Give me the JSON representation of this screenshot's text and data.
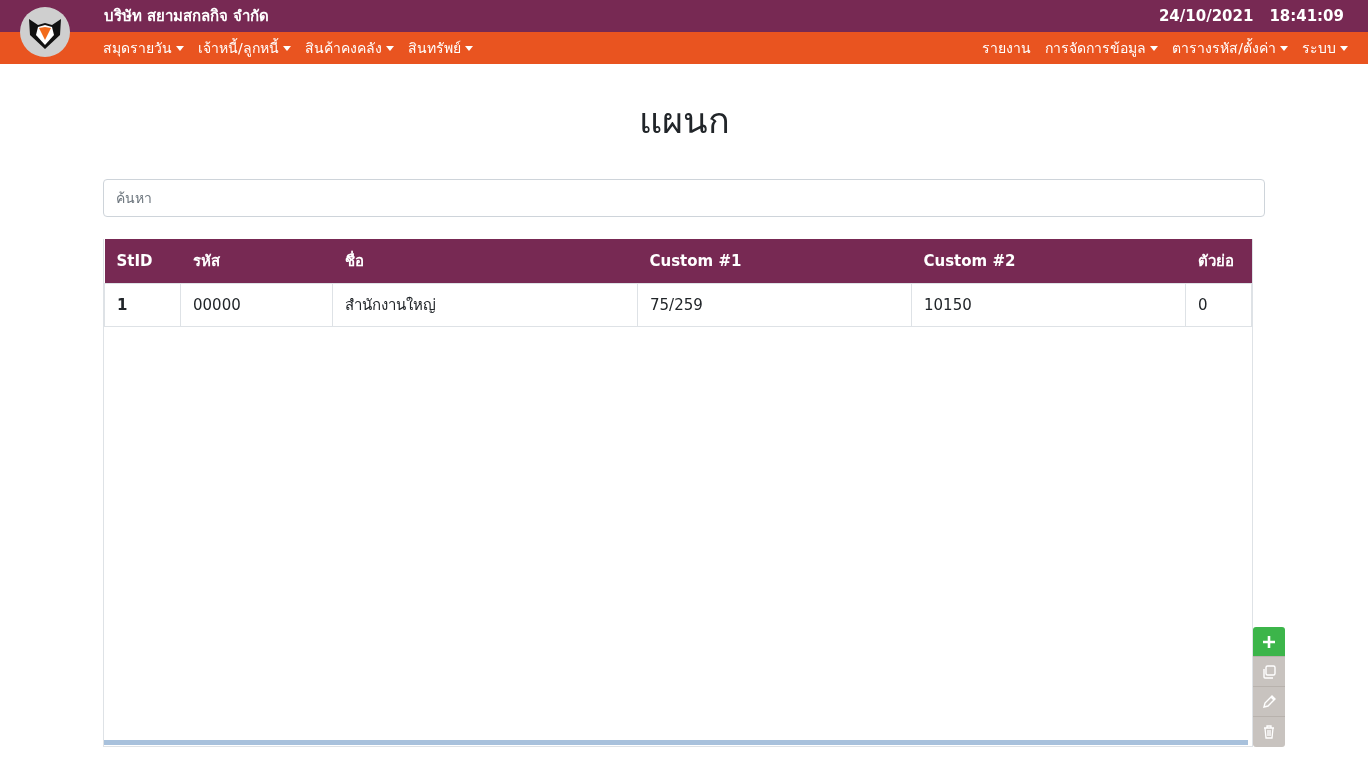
{
  "header": {
    "company": "บริษัท สยามสกลกิจ จำกัด",
    "date": "24/10/2021",
    "time": "18:41:09"
  },
  "nav_left": [
    {
      "label": "สมุดรายวัน",
      "dropdown": true
    },
    {
      "label": "เจ้าหนี้/ลูกหนี้",
      "dropdown": true
    },
    {
      "label": "สินค้าคงคลัง",
      "dropdown": true
    },
    {
      "label": "สินทรัพย์",
      "dropdown": true
    }
  ],
  "nav_right": [
    {
      "label": "รายงาน",
      "dropdown": false
    },
    {
      "label": "การจัดการข้อมูล",
      "dropdown": true
    },
    {
      "label": "ตารางรหัส/ตั้งค่า",
      "dropdown": true
    },
    {
      "label": "ระบบ",
      "dropdown": true
    }
  ],
  "page_title": "แผนก",
  "search": {
    "placeholder": "ค้นหา"
  },
  "table": {
    "columns": [
      "StID",
      "รหัส",
      "ชื่อ",
      "Custom #1",
      "Custom #2",
      "ตัวย่อ"
    ],
    "rows": [
      {
        "cells": [
          "1",
          "00000",
          "สำนักงานใหญ่",
          "75/259",
          "10150",
          "0"
        ],
        "selected": false
      }
    ]
  },
  "actions": [
    {
      "kind": "add",
      "disabled": false
    },
    {
      "kind": "copy",
      "disabled": true
    },
    {
      "kind": "edit",
      "disabled": true
    },
    {
      "kind": "delete",
      "disabled": true
    }
  ]
}
